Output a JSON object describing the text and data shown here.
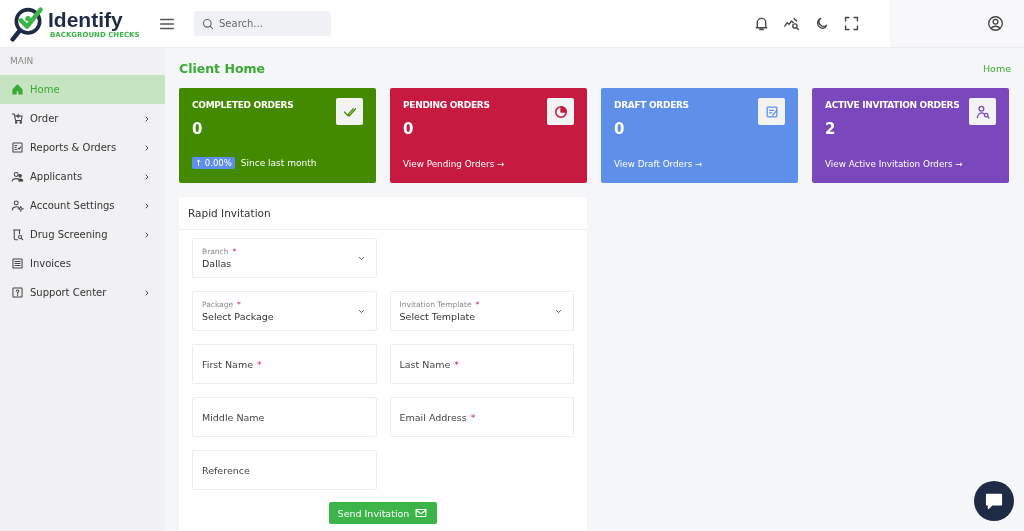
{
  "header": {
    "logo": {
      "name": "Identify",
      "tagline": "BACKGROUND CHECKS"
    },
    "search": {
      "placeholder": "Search..."
    }
  },
  "sidebar": {
    "section": "MAIN",
    "items": [
      {
        "label": "Home",
        "selected": true,
        "has_submenu": false
      },
      {
        "label": "Order",
        "selected": false,
        "has_submenu": true
      },
      {
        "label": "Reports & Orders",
        "selected": false,
        "has_submenu": true
      },
      {
        "label": "Applicants",
        "selected": false,
        "has_submenu": true
      },
      {
        "label": "Account Settings",
        "selected": false,
        "has_submenu": true
      },
      {
        "label": "Drug Screening",
        "selected": false,
        "has_submenu": true
      },
      {
        "label": "Invoices",
        "selected": false,
        "has_submenu": false
      },
      {
        "label": "Support Center",
        "selected": false,
        "has_submenu": true
      }
    ]
  },
  "page": {
    "title": "Client Home",
    "breadcrumb": "Home"
  },
  "cards": [
    {
      "title": "COMPLETED ORDERS",
      "count": "0",
      "color": "#448a00",
      "badge": "↑ 0.00%",
      "note": "Since last month"
    },
    {
      "title": "PENDING ORDERS",
      "count": "0",
      "color": "#c71a41",
      "link": "View Pending Orders →"
    },
    {
      "title": "DRAFT ORDERS",
      "count": "0",
      "color": "#5e90ea",
      "link": "View Draft Orders →"
    },
    {
      "title": "ACTIVE INVITATION ORDERS",
      "count": "2",
      "color": "#7a47bd",
      "link": "View Active Invitation Orders →"
    }
  ],
  "form": {
    "title": "Rapid Invitation",
    "rows": [
      [
        {
          "kind": "select",
          "label": "Branch",
          "required_mark": "*",
          "value": "Dallas"
        }
      ],
      [
        {
          "kind": "select",
          "label": "Package",
          "required_mark": "*",
          "value": "Select Package"
        },
        {
          "kind": "select",
          "label": "Invitation Template",
          "required_mark": "*",
          "value": "Select Template"
        }
      ],
      [
        {
          "kind": "text",
          "label": "First Name",
          "required_mark": "*"
        },
        {
          "kind": "text",
          "label": "Last Name",
          "required_mark": "*"
        }
      ],
      [
        {
          "kind": "text",
          "label": "Middle Name"
        },
        {
          "kind": "text",
          "label": "Email Address",
          "required_mark": "*"
        }
      ],
      [
        {
          "kind": "text",
          "label": "Reference"
        }
      ]
    ],
    "submit": "Send Invitation"
  }
}
